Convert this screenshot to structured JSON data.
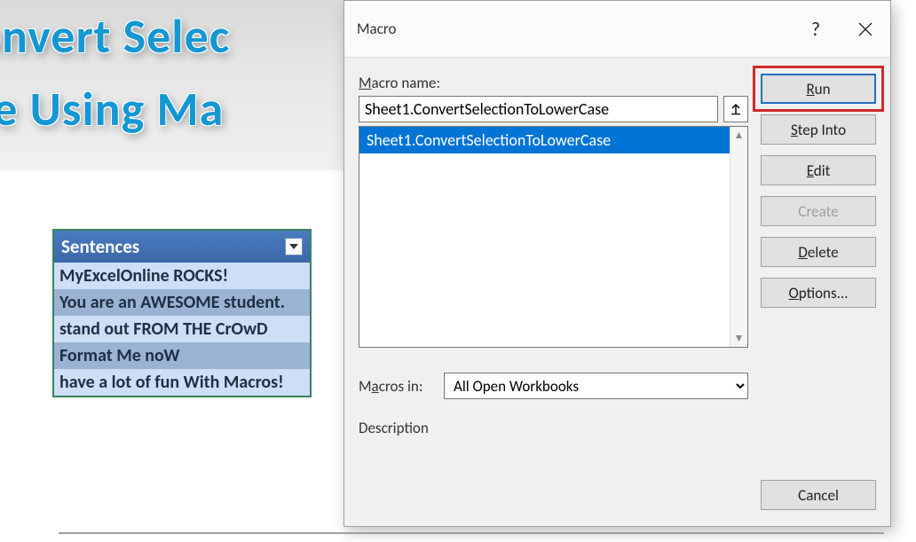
{
  "banner": {
    "line1": "onvert Selec",
    "line2": "ase Using Ma"
  },
  "table": {
    "header": "Sentences",
    "rows": [
      "MyExcelOnline ROCKS!",
      "You are an AWESOME student.",
      "stand out FROM THE CrOwD",
      "Format Me noW",
      "have a lot of fun With Macros!"
    ]
  },
  "dialog": {
    "title": "Macro",
    "help_symbol": "?",
    "labels": {
      "macro_name_pre": "M",
      "macro_name_post": "acro name:",
      "macros_in_pre": "M",
      "macros_in_post": "acros in:",
      "description": "Description"
    },
    "macro_name_value": "Sheet1.ConvertSelectionToLowerCase",
    "list_items": [
      "Sheet1.ConvertSelectionToLowerCase"
    ],
    "macros_in_value": "All Open Workbooks",
    "buttons": {
      "run_pre": "R",
      "run_post": "un",
      "step_pre": "S",
      "step_post": "tep Into",
      "edit_pre": "E",
      "edit_post": "dit",
      "create": "Create",
      "delete_pre": "D",
      "delete_post": "elete",
      "options_pre": "O",
      "options_post": "ptions...",
      "cancel": "Cancel"
    }
  }
}
